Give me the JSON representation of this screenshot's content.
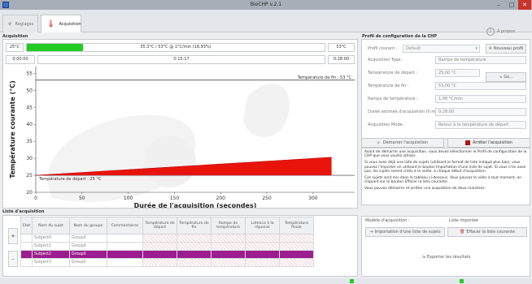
{
  "window": {
    "title": "BioCHP v.2.1",
    "minimize": "–",
    "maximize": "□",
    "close": "✕"
  },
  "tabs": [
    {
      "label": "Réglages",
      "icon": "gear-icon"
    },
    {
      "label": "Acquisition",
      "icon": "thermometer-icon"
    }
  ],
  "about": {
    "label": "A propos",
    "icon": "info-icon"
  },
  "acquisition": {
    "title": "Acquisition",
    "temp_start": "25°C",
    "temp_status": "35,3°C / 53°C @ 1°C/min (18,93%)",
    "temp_end": "53°C",
    "progress": 0.1893,
    "time_start": "0:00:00",
    "time_current": "0:15:17",
    "time_end": "0:28:00",
    "time_progress": 0.0
  },
  "chart_data": {
    "type": "area",
    "title": "",
    "xlabel": "Durée de l'acquisition (secondes)",
    "ylabel": "Température courante (°C)",
    "xlim": [
      0,
      345
    ],
    "ylim": [
      20,
      57
    ],
    "xticks": [
      0,
      50,
      100,
      150,
      200,
      250,
      300
    ],
    "yticks": [
      20,
      25,
      30,
      35,
      40,
      45,
      50,
      55
    ],
    "grid": false,
    "lines": [
      {
        "y": 53,
        "label": "Température de fin : 53 °C"
      },
      {
        "y": 25,
        "label": "Température de départ : 25 °C"
      }
    ],
    "series": [
      {
        "x": [
          0,
          320
        ],
        "y": [
          25,
          30.3
        ],
        "color": "#e8140c"
      }
    ]
  },
  "profile": {
    "title": "Profil de configuration de la CHP",
    "current_label": "Profil courant :",
    "current_value": "Default",
    "new_profile": "Nouveau profil",
    "rows": [
      {
        "label": "Acquisition Type:",
        "value": "Rampe de température"
      },
      {
        "label": "Température de départ :",
        "value": "25,00 °C"
      },
      {
        "label": "Température de fin :",
        "value": "53,00 °C"
      },
      {
        "label": "Rampe de température :",
        "value": "1,00 °C/min"
      },
      {
        "label": "Durée estimée d'acquisition (h:mm:ss) :",
        "value": "0:28:00"
      },
      {
        "label": "Acquisition Mode:",
        "value": "Retour à la température de départ"
      }
    ],
    "go_button": "Go...",
    "start_button": "Démarrer l'acquisition",
    "stop_button": "Arrêter l'acquisition",
    "help": [
      "Avant de démarrer une acquisition, vous devez sélectionner le Profil de configuration de la CHP que vous voulez utiliser.",
      "Si vous avez déjà une liste de sujets (utilisant le format de liste indiqué plus bas), vous pouvez l'importer en utilisant le bouton Importation d'une liste de sujet. Si vous n'en avez pas, les sujets seront créés à la volée, à chaque début d'acquisition.",
      "Ces sujets sont mis dans le tableau ci-dessous. Vous pouvez le vider à tout moment, en cliquant sur le bouton Effacer la liste courante.",
      "Vous pouvez démarrer et arrêter une acquisition de deux manières:"
    ]
  },
  "subjects": {
    "title": "Liste d'acquisition",
    "columns": [
      "Etat",
      "Nom du sujet",
      "Nom du groupe",
      "Commentaires",
      "Température de départ",
      "Température de fin",
      "Rampe de température",
      "Latence à la réponse",
      "Température finale"
    ],
    "rows": [
      {
        "name": "Subject0",
        "group": "Group0"
      },
      {
        "name": "Subject1",
        "group": "Group0"
      },
      {
        "name": "Subject2",
        "group": "Group0"
      },
      {
        "name": "Subject3",
        "group": "Group0"
      }
    ],
    "selected_index": 2,
    "add": "+",
    "remove": "–"
  },
  "actions": {
    "mode_label": "Modèle d'acquisition :",
    "mode_value": "Liste importée",
    "import_button": "Importation d'une liste de sujets",
    "clear_button": "Effacer la liste courante",
    "export_button": "Exporter les résultats"
  },
  "colors": {
    "accent": "#9b1d8f",
    "red": "#e8140c",
    "green": "#22cc22"
  }
}
